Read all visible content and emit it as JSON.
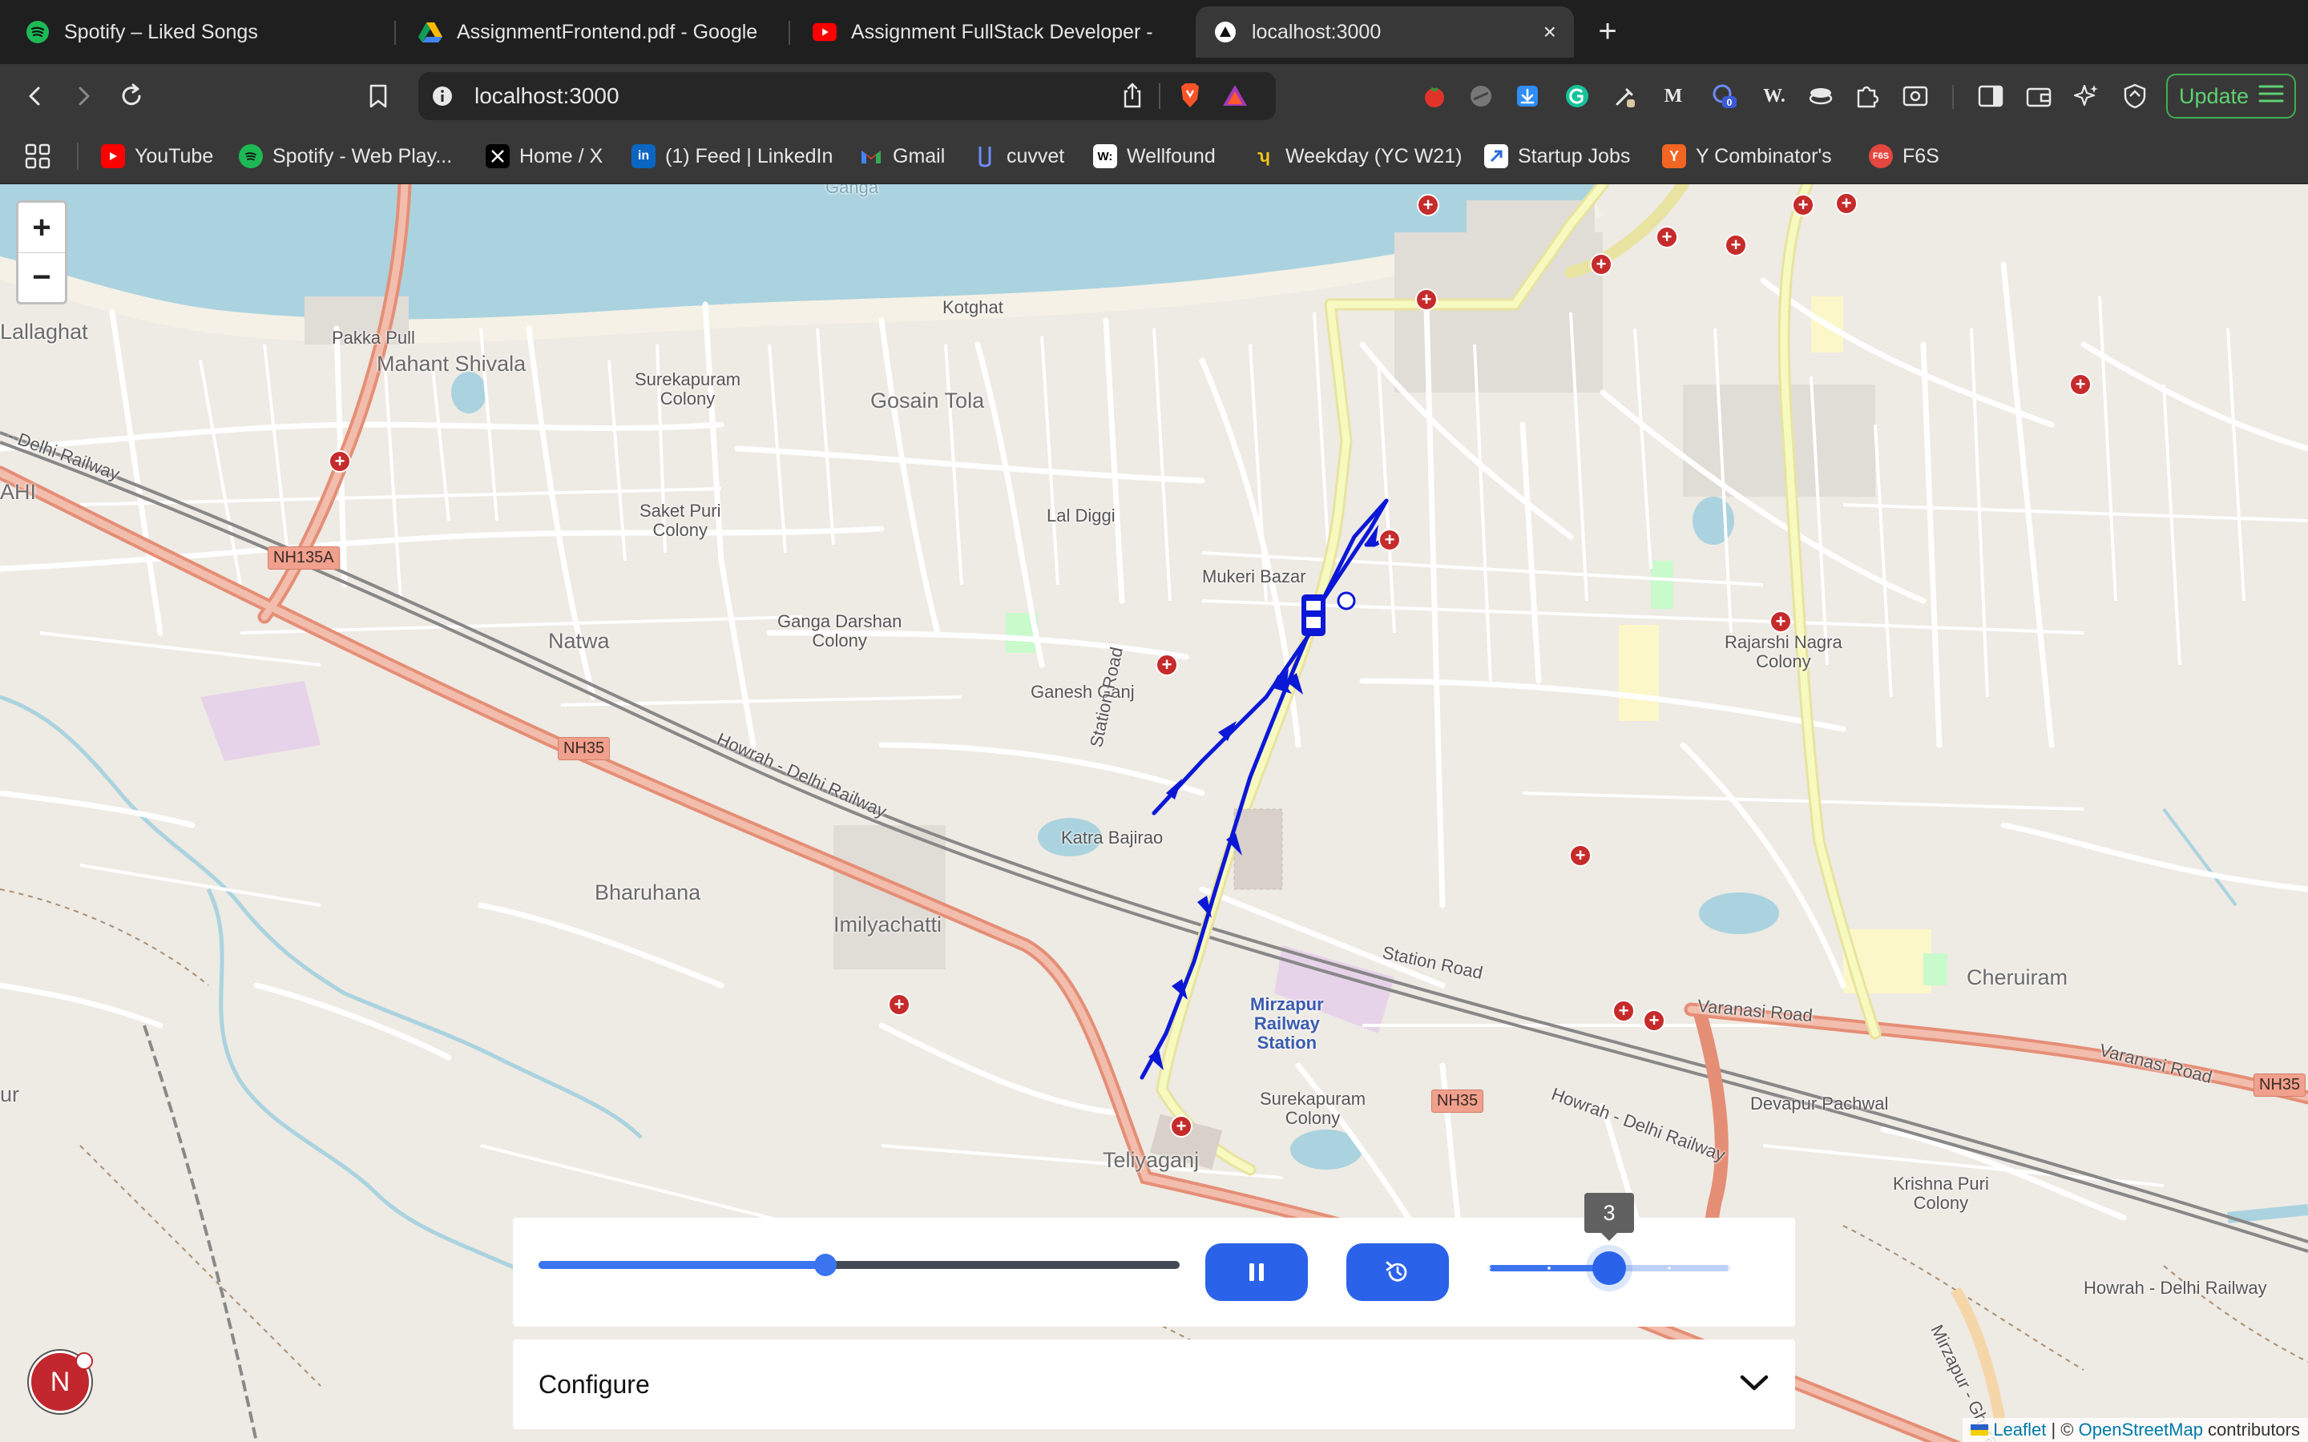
{
  "browser": {
    "tabs": [
      {
        "title": "Spotify – Liked Songs",
        "icon": "spotify-icon"
      },
      {
        "title": "AssignmentFrontend.pdf - Google",
        "icon": "google-drive-icon"
      },
      {
        "title": "Assignment FullStack Developer -",
        "icon": "youtube-icon"
      },
      {
        "title": "localhost:3000",
        "icon": "nextjs-icon",
        "active": true
      }
    ],
    "new_tab_symbol": "+",
    "close_symbol": "×",
    "url": "localhost:3000",
    "update_label": "Update",
    "extension_badge": "0",
    "bookmarks": [
      {
        "label": "YouTube",
        "icon": "youtube-icon",
        "color": "#ff0000"
      },
      {
        "label": "Spotify - Web Play...",
        "icon": "spotify-icon",
        "color": "#1db954"
      },
      {
        "label": "Home / X",
        "icon": "x-icon",
        "color": "#000000"
      },
      {
        "label": "(1) Feed | LinkedIn",
        "icon": "linkedin-icon",
        "color": "#0a66c2"
      },
      {
        "label": "Gmail",
        "icon": "gmail-icon",
        "color": "#ea4335"
      },
      {
        "label": "cuvvet",
        "icon": "cuvette-icon",
        "color": "#4a6cf7"
      },
      {
        "label": "Wellfound",
        "icon": "wellfound-icon",
        "color": "#ffffff"
      },
      {
        "label": "Weekday (YC W21)",
        "icon": "weekday-icon",
        "color": "#f5c518"
      },
      {
        "label": "Startup Jobs",
        "icon": "startup-jobs-icon",
        "color": "#2d6cdf"
      },
      {
        "label": "Y Combinator's",
        "icon": "ycombinator-icon",
        "color": "#f26522"
      },
      {
        "label": "F6S",
        "icon": "f6s-icon",
        "color": "#e4473f"
      }
    ]
  },
  "map": {
    "zoom_in_label": "+",
    "zoom_out_label": "−",
    "places": {
      "ganga": "Ganga",
      "lallaghat": "Lallaghat",
      "pakka_pull": "Pakka Pull",
      "mahant_shivala": "Mahant Shivala",
      "kotghat": "Kotghat",
      "surekapuram_colony_n": "Surekapuram\nColony",
      "gosain_tola": "Gosain Tola",
      "saket_puri": "Saket Puri\nColony",
      "lal_diggi": "Lal Diggi",
      "mukeri_bazar": "Mukeri Bazar",
      "ganga_darshan": "Ganga Darshan\nColony",
      "ganesh_ganj": "Ganesh Ganj",
      "natwa": "Natwa",
      "ahi": "AHI",
      "station_road_v": "Station Road",
      "katra_bajirao": "Katra Bajirao",
      "bharuhana": "Bharuhana",
      "imilyachatti": "Imilyachatti",
      "rajarshi_nagra": "Rajarshi Nagra\nColony",
      "station_road_h": "Station Road",
      "mirzapur_station": "Mirzapur\nRailway\nStation",
      "cheruiram": "Cheruiram",
      "varanasi_road_1": "Varanasi Road",
      "varanasi_road_2": "Varanasi Road",
      "devapur_pachwal": "Devapur Pachwal",
      "surekapuram_colony_s": "Surekapuram\nColony",
      "teliyaganj": "Teliyaganj",
      "krishna_puri": "Krishna Puri\nColony",
      "howrah_delhi_1": "Howrah - Delhi Railway",
      "howrah_delhi_2": "Howrah - Delhi Railway",
      "howrah_delhi_3": "Howrah - Delhi Railway",
      "delhi_railway_w": "- Delhi Railway",
      "mirzapur_ghorawal": "Mirzapur - Ghoraw",
      "ur": "ur"
    },
    "shields": {
      "nh135a": "NH135A",
      "nh35_w": "NH35",
      "nh35_s": "NH35",
      "nh35_e": "NH35"
    },
    "attribution": {
      "leaflet": "Leaflet",
      "separator": " | © ",
      "osm": "OpenStreetMap",
      "suffix": " contributors"
    }
  },
  "playback": {
    "progress_fraction": 0.447,
    "speed_value": "3",
    "speed_min": 1,
    "speed_max": 5,
    "play_state": "playing",
    "play_button_icon": "pause-icon",
    "replay_button_icon": "replay-icon",
    "accent_color": "#2a63e9"
  },
  "configure": {
    "label": "Configure"
  },
  "dev_badge": {
    "letter": "N"
  }
}
